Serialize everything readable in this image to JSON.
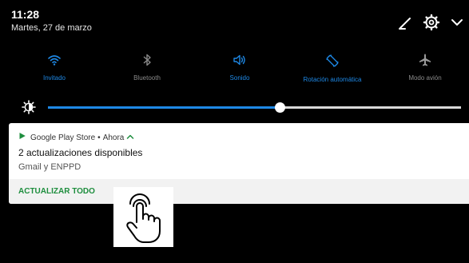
{
  "status": {
    "time": "11:28",
    "date": "Martes, 27 de marzo"
  },
  "header_icons": [
    "edit-icon",
    "settings-icon",
    "chevron-down-icon"
  ],
  "quick_settings": [
    {
      "label": "Invitado",
      "icon": "wifi-icon",
      "active": true
    },
    {
      "label": "Bluetooth",
      "icon": "bluetooth-icon",
      "active": false
    },
    {
      "label": "Sonido",
      "icon": "volume-icon",
      "active": true
    },
    {
      "label": "Rotación automática",
      "icon": "auto-rotate-icon",
      "active": true
    },
    {
      "label": "Modo avión",
      "icon": "airplane-icon",
      "active": false
    }
  ],
  "brightness": {
    "level": 0.56,
    "icon": "brightness-icon"
  },
  "notification": {
    "app": "Google Play Store",
    "separator": "•",
    "time": "Ahora",
    "title": "2 actualizaciones disponibles",
    "text": "Gmail y ENPPD",
    "action": "ACTUALIZAR TODO"
  },
  "colors": {
    "accent": "#1e88e5",
    "action": "#1e8e3e",
    "background": "#000000",
    "card": "#ffffff",
    "card_actions": "#f2f2f2"
  },
  "overlay": {
    "icon": "tap-hand-icon"
  }
}
